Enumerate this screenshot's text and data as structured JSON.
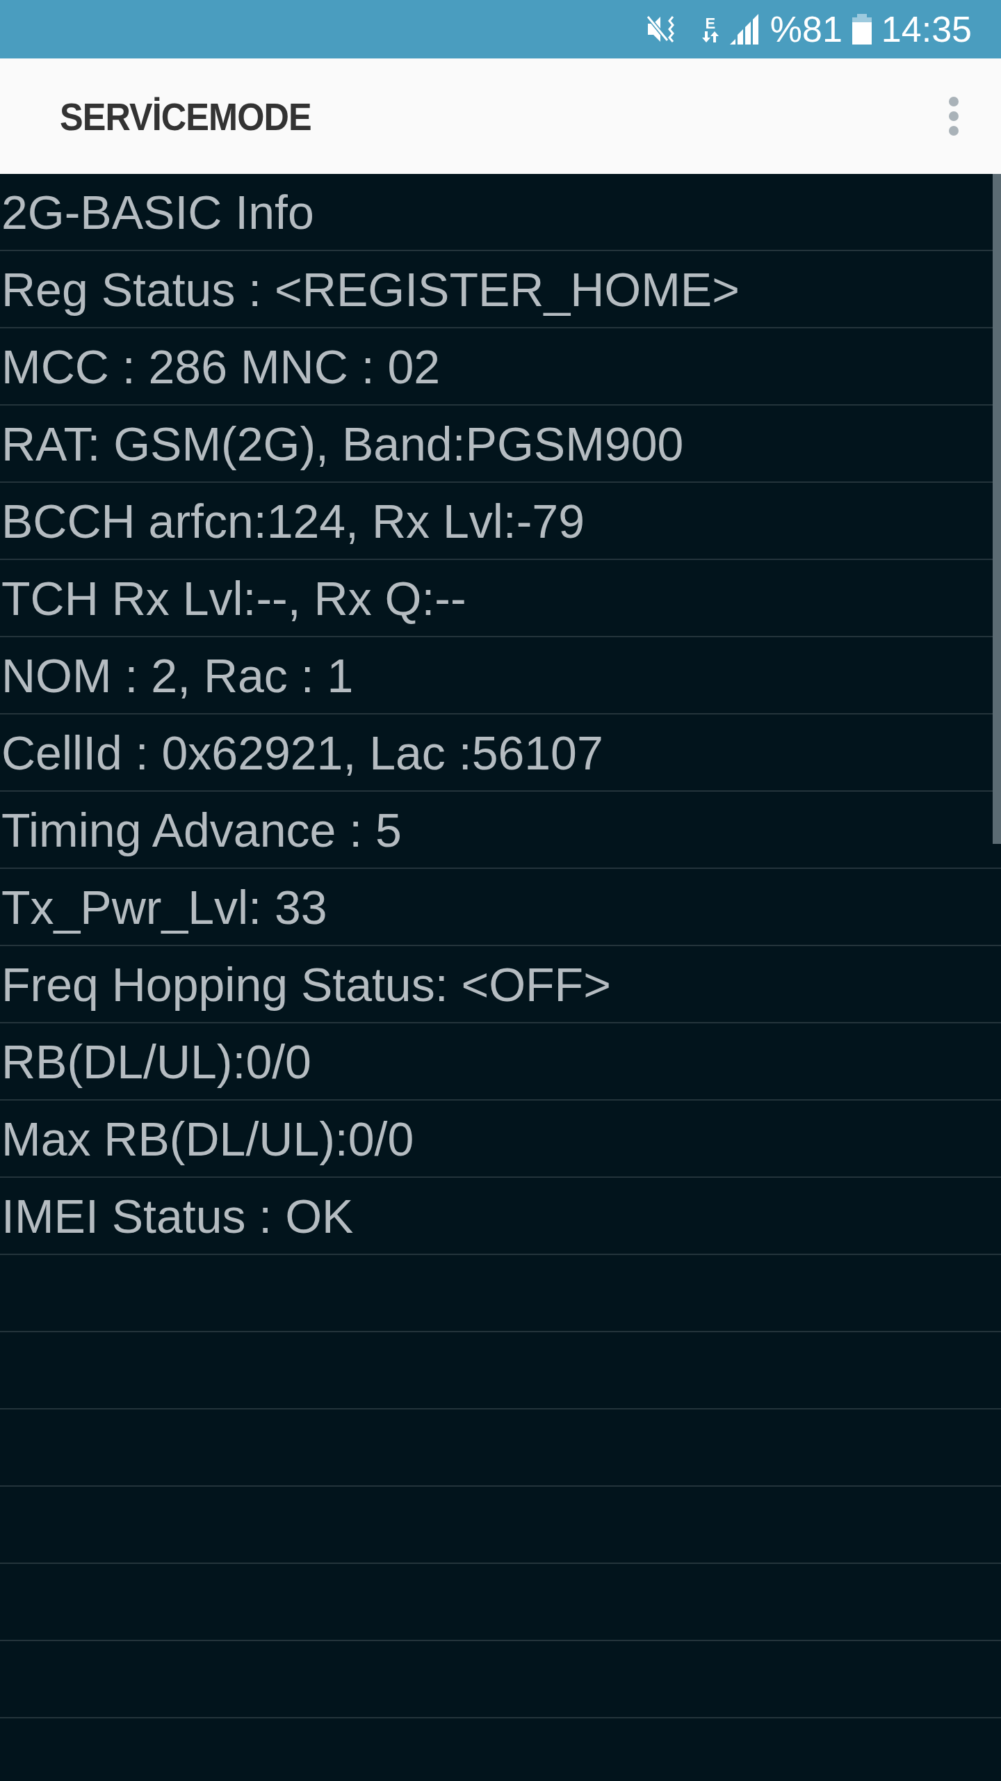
{
  "status_bar": {
    "battery": "%81",
    "time": "14:35",
    "network_type": "E"
  },
  "app_bar": {
    "title": "SERVİCEMODE"
  },
  "rows": [
    "2G-BASIC Info",
    "Reg Status : <REGISTER_HOME>",
    "MCC : 286 MNC : 02",
    "RAT: GSM(2G), Band:PGSM900",
    "BCCH arfcn:124, Rx Lvl:-79",
    "TCH Rx Lvl:--, Rx Q:--",
    "NOM : 2, Rac : 1",
    "CellId : 0x62921, Lac :56107",
    "Timing Advance : 5",
    "Tx_Pwr_Lvl: 33",
    "Freq Hopping Status: <OFF>",
    "RB(DL/UL):0/0",
    "Max RB(DL/UL):0/0",
    "IMEI Status : OK"
  ]
}
